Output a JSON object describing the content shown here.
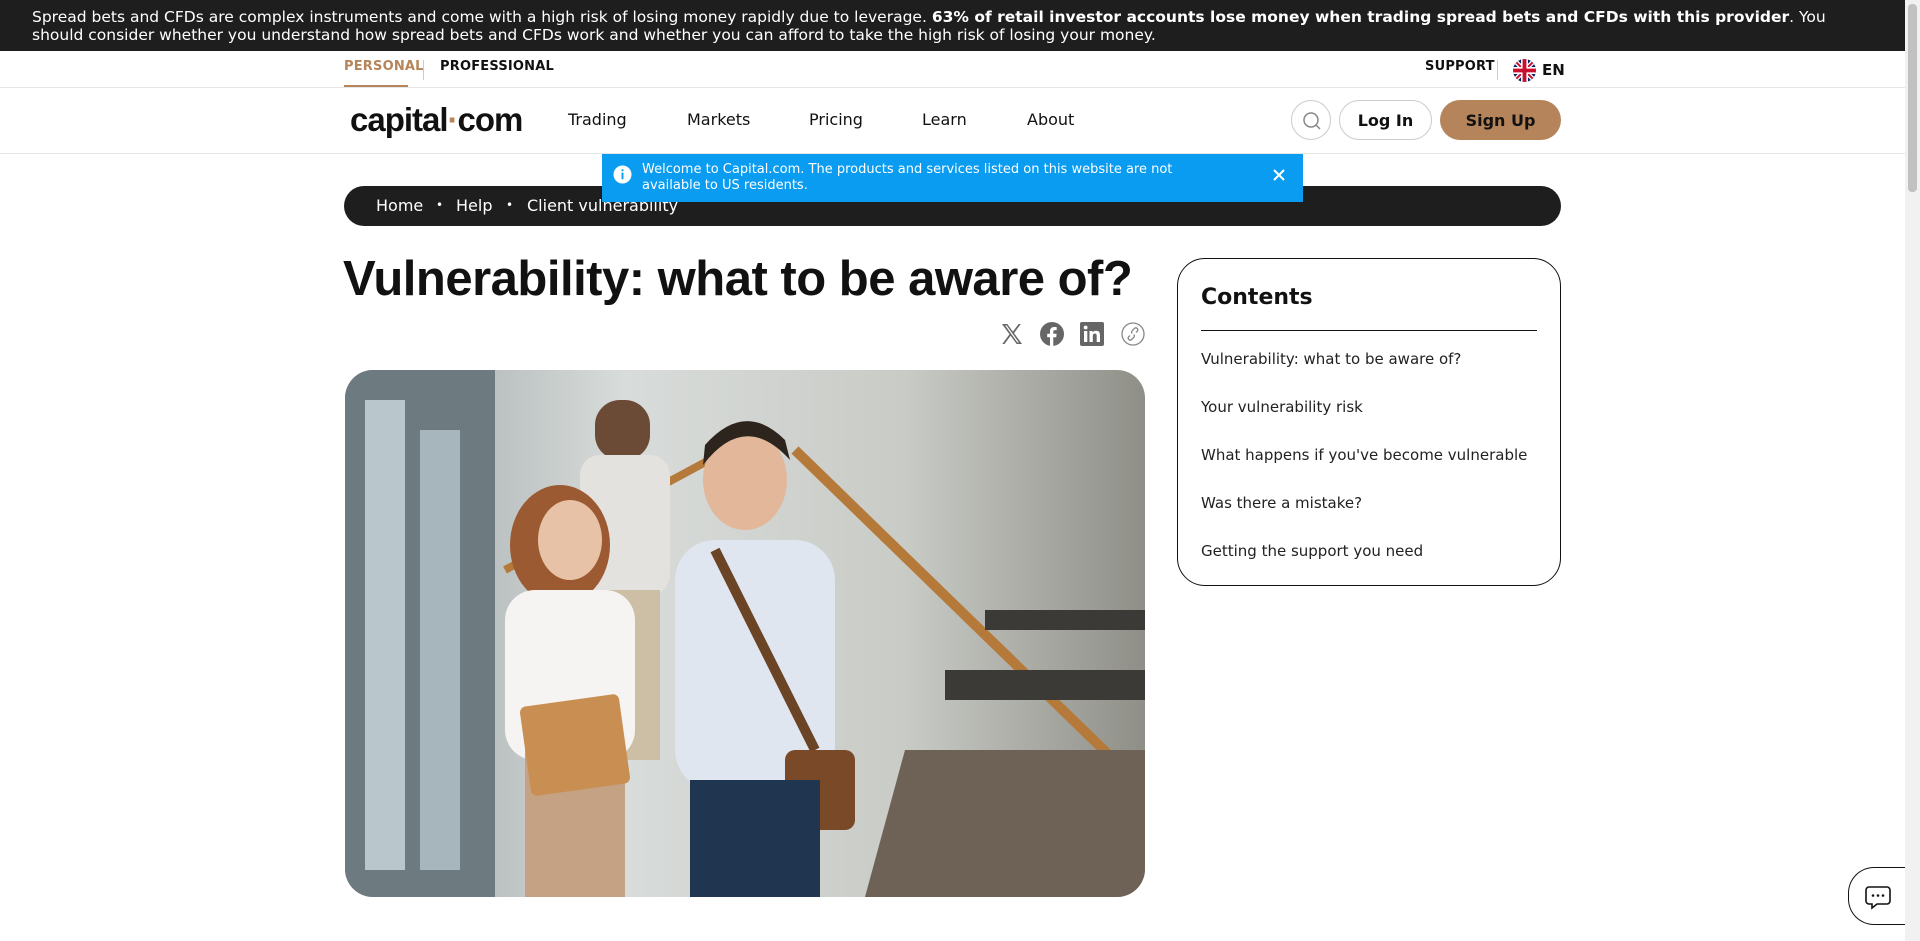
{
  "risk_warning": {
    "text_before": "Spread bets and CFDs are complex instruments and come with a high risk of losing money rapidly due to leverage. ",
    "text_bold": "63% of retail investor accounts lose money when trading spread bets and CFDs with this provider",
    "text_after": ". You should consider whether you understand how spread bets and CFDs work and whether you can afford to take the high risk of losing your money."
  },
  "segments": {
    "personal": "PERSONAL",
    "professional": "PROFESSIONAL"
  },
  "utility": {
    "support": "SUPPORT",
    "language": "EN"
  },
  "logo": {
    "main": "capital",
    "dot": "·",
    "suffix": "com"
  },
  "nav": {
    "items": [
      {
        "label": "Trading"
      },
      {
        "label": "Markets"
      },
      {
        "label": "Pricing"
      },
      {
        "label": "Learn"
      },
      {
        "label": "About"
      }
    ],
    "login": "Log In",
    "signup": "Sign Up"
  },
  "notice": {
    "text": "Welcome to Capital.com. The products and services listed on this website are not available to US residents."
  },
  "breadcrumb": {
    "items": [
      {
        "label": "Home"
      },
      {
        "label": "Help"
      },
      {
        "label": "Client vulnerability"
      }
    ],
    "separator": "•"
  },
  "article": {
    "title": "Vulnerability: what to be aware of?"
  },
  "toc": {
    "title": "Contents",
    "items": [
      {
        "label": "Vulnerability: what to be aware of?"
      },
      {
        "label": "Your vulnerability risk"
      },
      {
        "label": "What happens if you've become vulnerable"
      },
      {
        "label": "Was there a mistake?"
      },
      {
        "label": "Getting the support you need"
      }
    ]
  },
  "colors": {
    "accent": "#b5845a",
    "dark": "#1e1e1e",
    "notice_blue": "#0a9cf0"
  },
  "icons": {
    "share": [
      "x-icon",
      "facebook-icon",
      "linkedin-icon",
      "copy-link-icon"
    ],
    "chat": "chat-icon",
    "search": "search-icon",
    "info": "info-icon",
    "close": "close-icon",
    "flag": "uk-flag-icon"
  }
}
